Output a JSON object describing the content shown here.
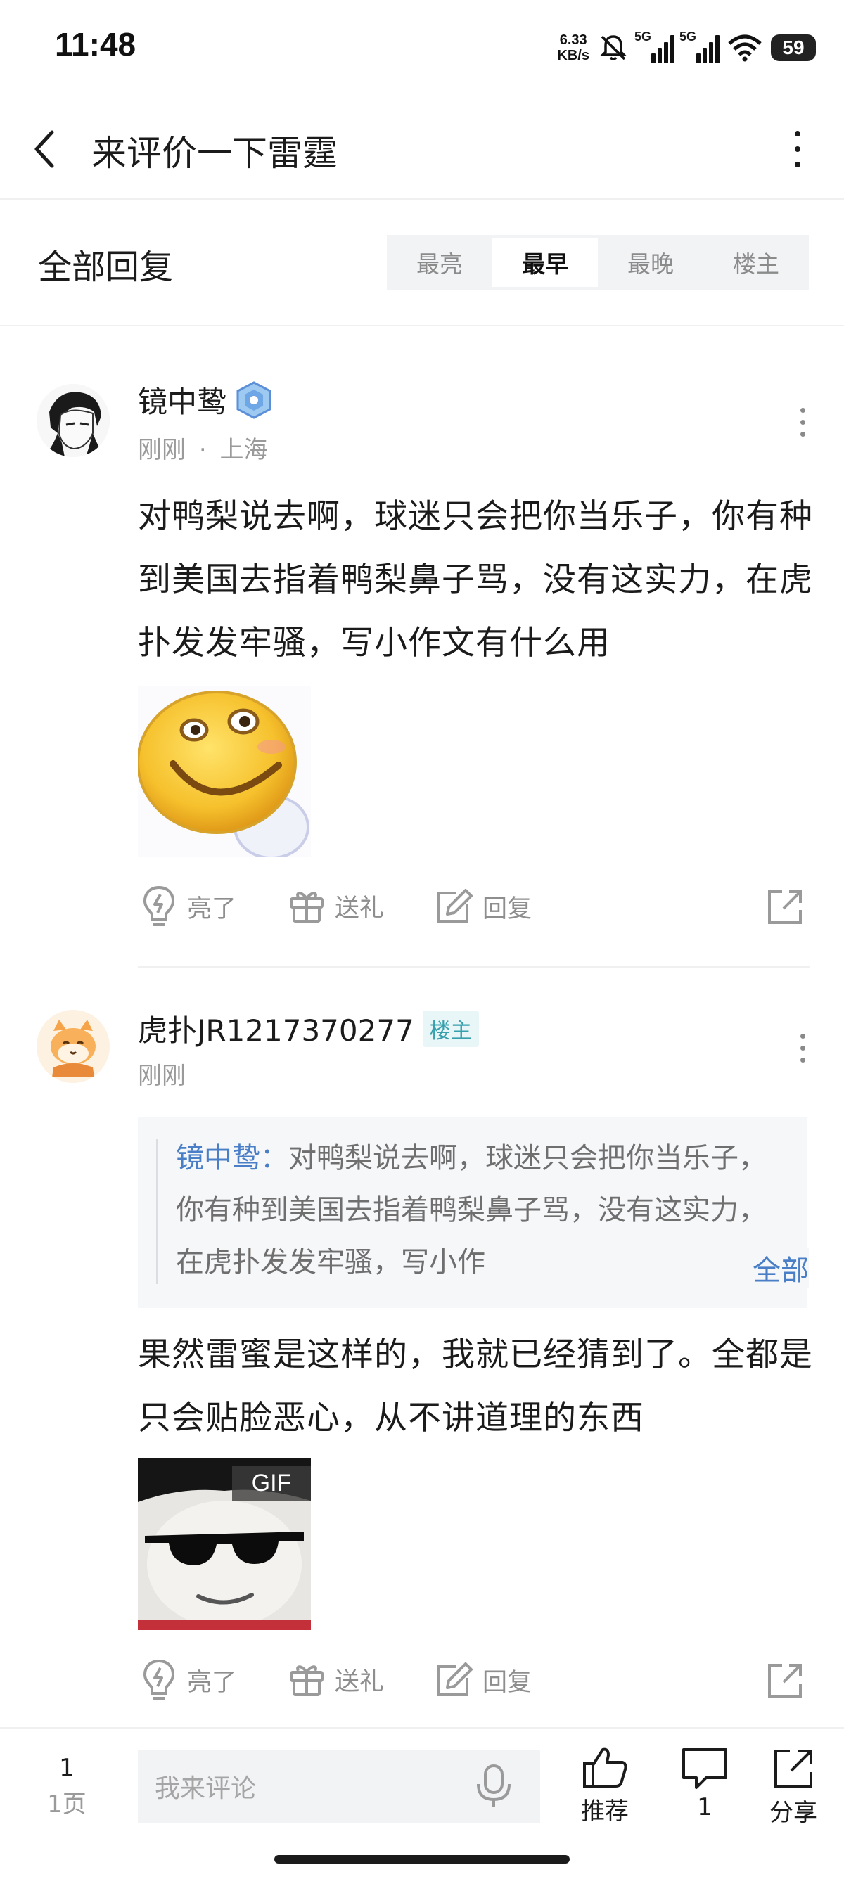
{
  "status_bar": {
    "time": "11:48",
    "net_speed_value": "6.33",
    "net_speed_unit": "KB/s",
    "signal1_label": "5G",
    "signal2_label": "5G",
    "battery": "59"
  },
  "header": {
    "title": "来评价一下雷霆",
    "back_icon": "chevron-left-icon",
    "menu_icon": "vertical-dots-icon"
  },
  "replies_section": {
    "title": "全部回复",
    "sort_tabs": [
      {
        "label": "最亮",
        "active": false
      },
      {
        "label": "最早",
        "active": true
      },
      {
        "label": "最晚",
        "active": false
      },
      {
        "label": "楼主",
        "active": false
      }
    ]
  },
  "comments": [
    {
      "username": "镜中鸷",
      "time": "刚刚",
      "location": "上海",
      "meta_separator": "·",
      "text": "对鸭梨说去啊，球迷只会把你当乐子，你有种到美国去指着鸭梨鼻子骂，没有这实力，在虎扑发发牢骚，写小作文有什么用",
      "image": "smiley-sticker",
      "actions": {
        "like": "亮了",
        "gift": "送礼",
        "reply": "回复"
      }
    },
    {
      "username": "虎扑JR1217370277",
      "author_tag": "楼主",
      "time": "刚刚",
      "quote": {
        "name": "镜中鸷：",
        "text": "对鸭梨说去啊，球迷只会把你当乐子，你有种到美国去指着鸭梨鼻子骂，没有这实力，在虎扑发发牢骚，写小作",
        "more": "全部"
      },
      "text": "果然雷蜜是这样的，我就已经猜到了。全都是只会贴脸恶心，从不讲道理的东西",
      "image_badge": "GIF",
      "image": "sunglasses-meme-gif",
      "actions": {
        "like": "亮了",
        "gift": "送礼",
        "reply": "回复"
      }
    }
  ],
  "bottom_bar": {
    "page_number": "1",
    "page_label": "1页",
    "comment_placeholder": "我来评论",
    "recommend_label": "推荐",
    "comment_count": "1",
    "share_label": "分享"
  }
}
